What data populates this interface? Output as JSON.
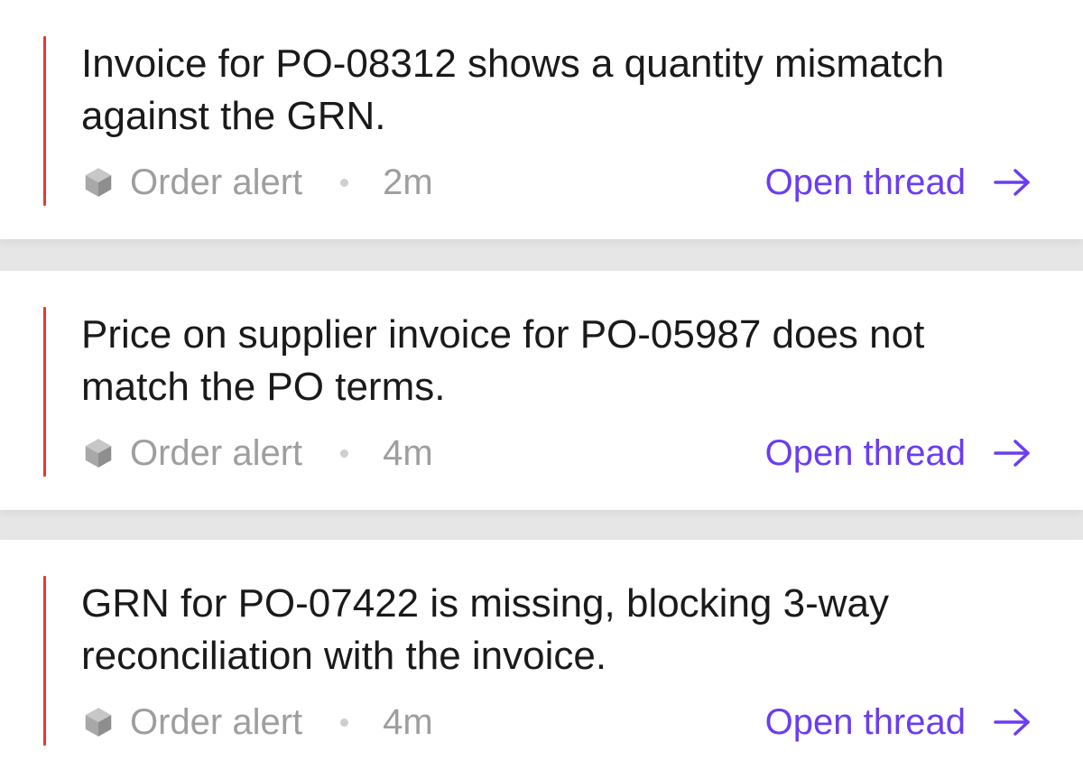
{
  "alerts": [
    {
      "message": "Invoice for PO-08312 shows a quantity mismatch against the GRN.",
      "category": "Order alert",
      "time": "2m",
      "action": "Open thread"
    },
    {
      "message": "Price on supplier invoice for PO-05987 does not match the PO terms.",
      "category": "Order alert",
      "time": "4m",
      "action": "Open thread"
    },
    {
      "message": "GRN for PO-07422 is missing, blocking 3-way reconciliation with the invoice.",
      "category": "Order alert",
      "time": "4m",
      "action": "Open thread"
    }
  ],
  "icons": {
    "category": "cube-icon",
    "action": "arrow-right-icon"
  },
  "colors": {
    "accent": "#e53935",
    "link": "#6a3df2",
    "muted_text": "#9e9e9e",
    "body_text": "#1a1a1a"
  }
}
